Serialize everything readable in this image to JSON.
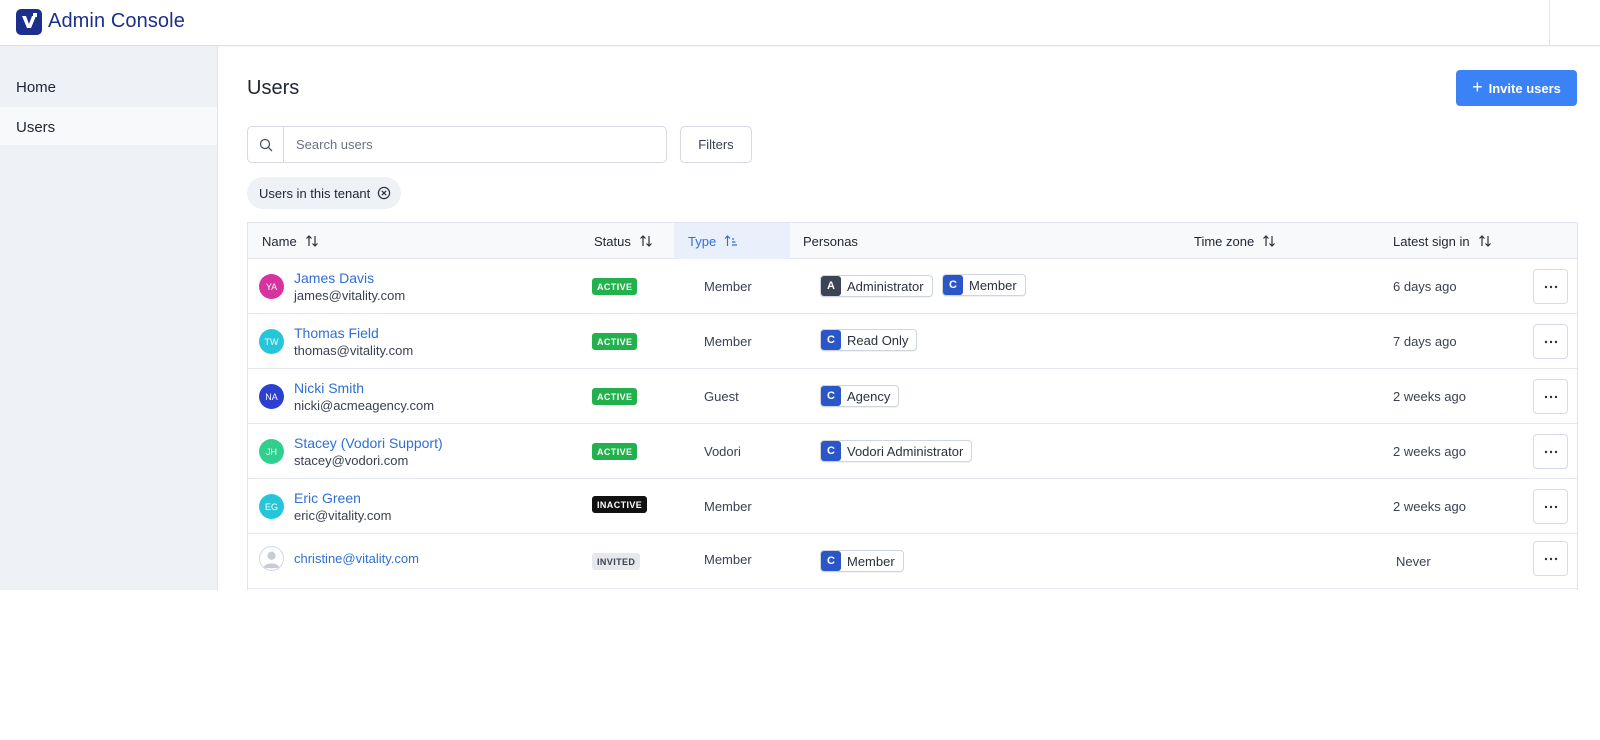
{
  "header": {
    "app_title": "Admin Console",
    "logo_icon": "brand-logo-icon"
  },
  "sidebar": {
    "items": [
      {
        "label": "Home"
      },
      {
        "label": "Users",
        "selected": true
      }
    ]
  },
  "main": {
    "title": "Users",
    "invite_button": "Invite users",
    "search_placeholder": "Search users",
    "filters_button": "Filters",
    "active_filter_chip": "Users in this tenant"
  },
  "table": {
    "columns": [
      "Name",
      "Status",
      "Type",
      "Personas",
      "Time zone",
      "Latest sign in"
    ],
    "sorted_column": "Type",
    "rows": [
      {
        "initials": "YA",
        "avatar_color": "#d6339f",
        "name": "James Davis",
        "email": "james@vitality.com",
        "status": "ACTIVE",
        "type": "Member",
        "personas": [
          {
            "letter": "A",
            "label": "Administrator"
          },
          {
            "letter": "C",
            "label": "Member"
          }
        ],
        "time_zone": "",
        "latest_sign_in": "6 days ago"
      },
      {
        "initials": "TW",
        "avatar_color": "#26c6da",
        "name": "Thomas Field",
        "email": "thomas@vitality.com",
        "status": "ACTIVE",
        "type": "Member",
        "personas": [
          {
            "letter": "C",
            "label": "Read Only"
          }
        ],
        "time_zone": "",
        "latest_sign_in": "7 days ago"
      },
      {
        "initials": "NA",
        "avatar_color": "#2c3fcf",
        "name": "Nicki Smith",
        "email": "nicki@acmeagency.com",
        "status": "ACTIVE",
        "type": "Guest",
        "personas": [
          {
            "letter": "C",
            "label": "Agency"
          }
        ],
        "time_zone": "",
        "latest_sign_in": "2 weeks ago"
      },
      {
        "initials": "JH",
        "avatar_color": "#2fd08f",
        "name": "Stacey (Vodori Support)",
        "email": "stacey@vodori.com",
        "status": "ACTIVE",
        "type": "Vodori",
        "personas": [
          {
            "letter": "C",
            "label": "Vodori Administrator"
          }
        ],
        "time_zone": "",
        "latest_sign_in": "2 weeks ago"
      },
      {
        "initials": "EG",
        "avatar_color": "#26c6da",
        "name": "Eric Green",
        "email": "eric@vitality.com",
        "status": "INACTIVE",
        "type": "Member",
        "personas": [],
        "time_zone": "",
        "latest_sign_in": "2 weeks ago"
      },
      {
        "initials": "",
        "avatar_color": "#c8ccd3",
        "name": "",
        "email": "christine@vitality.com",
        "status": "INVITED",
        "type": "Member",
        "personas": [
          {
            "letter": "C",
            "label": "Member"
          }
        ],
        "time_zone": "",
        "latest_sign_in": "Never"
      }
    ]
  },
  "colors": {
    "accent": "#3b82f6",
    "brand": "#1c2f8c",
    "status_active": "#22b14c",
    "status_inactive": "#111111",
    "status_invited": "#e6e8ec"
  }
}
